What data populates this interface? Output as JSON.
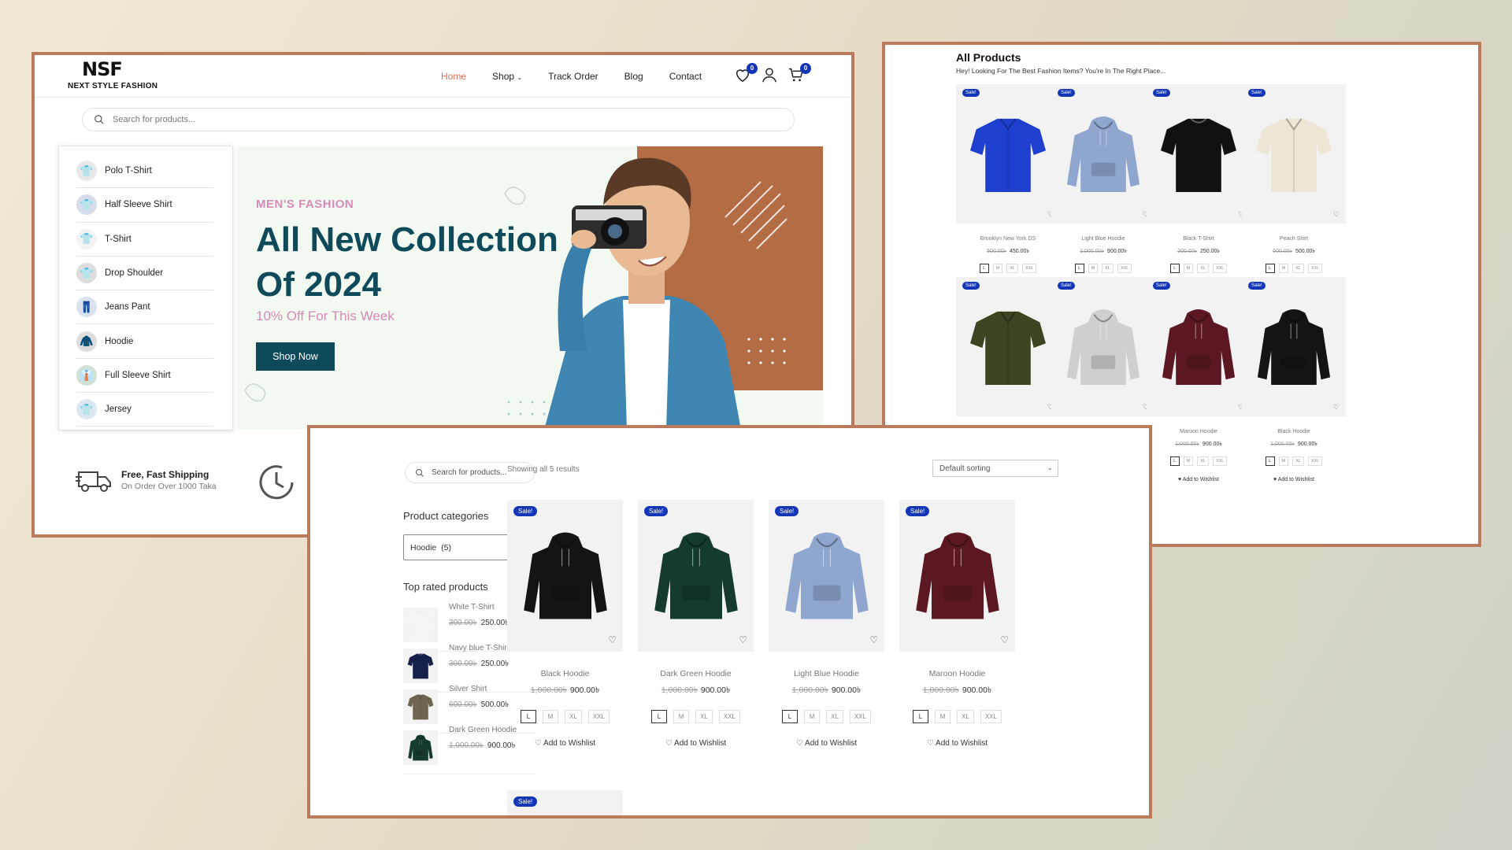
{
  "frame_a": {
    "logo_mark": "NSF",
    "logo_text": "NEXT STYLE FASHION",
    "nav": [
      "Home",
      "Shop",
      "Track Order",
      "Blog",
      "Contact"
    ],
    "wishlist_count": "0",
    "cart_count": "0",
    "search_placeholder": "Search for products...",
    "categories": [
      "Polo T-Shirt",
      "Half Sleeve Shirt",
      "T-Shirt",
      "Drop Shoulder",
      "Jeans Pant",
      "Hoodie",
      "Full Sleeve Shirt",
      "Jersey"
    ],
    "hero": {
      "subtitle": "MEN'S FASHION",
      "title": "All New Collection Of 2024",
      "offer": "10% Off For This Week",
      "button": "Shop Now"
    },
    "shipping": {
      "title": "Free, Fast Shipping",
      "subtitle": "On Order Over 1000 Taka"
    },
    "accent_color": "#e56f5c",
    "brand_color": "#0f4a5b"
  },
  "frame_b": {
    "title": "All Products",
    "subtitle": "Hey! Looking For The Best Fashion Items? You're In The Right Place...",
    "sale_label": "Sale!",
    "wishlist_label": "Add to Wishlist",
    "sizes": [
      "L",
      "M",
      "XL",
      "XXL"
    ],
    "products": [
      {
        "name": "Brooklyn New York DS",
        "old": "500.00৳",
        "price": "450.00৳",
        "color": "#1f3fcf"
      },
      {
        "name": "Light Blue Hoodie",
        "old": "1,000.00৳",
        "price": "900.00৳",
        "color": "#8fa6cf"
      },
      {
        "name": "Black T-Shirt",
        "old": "300.00৳",
        "price": "250.00৳",
        "color": "#111111"
      },
      {
        "name": "Peach Shirt",
        "old": "600.00৳",
        "price": "500.00৳",
        "color": "#ece6d7"
      },
      {
        "name": "",
        "old": "",
        "price": "",
        "color": "#3c4522"
      },
      {
        "name": "",
        "old": "",
        "price": "",
        "color": "#cfcfcf"
      },
      {
        "name": "Maroon Hoodie",
        "old": "1,000.00৳",
        "price": "900.00৳",
        "color": "#5c1822"
      },
      {
        "name": "Black Hoodie",
        "old": "1,000.00৳",
        "price": "900.00৳",
        "color": "#141414"
      }
    ]
  },
  "frame_c": {
    "search_placeholder": "Search for products...",
    "categories_heading": "Product categories",
    "selected_category": "Hoodie  (5)",
    "top_rated_heading": "Top rated products",
    "top_rated": [
      {
        "name": "White T-Shirt",
        "old": "300.00৳",
        "price": "250.00৳",
        "color": "#f4f4f4"
      },
      {
        "name": "Navy blue T-Shirt",
        "old": "300.00৳",
        "price": "250.00৳",
        "color": "#16204a"
      },
      {
        "name": "Silver Shirt",
        "old": "600.00৳",
        "price": "500.00৳",
        "color": "#6e6650"
      },
      {
        "name": "Dark Green Hoodie",
        "old": "1,000.00৳",
        "price": "900.00৳",
        "color": "#143b2c"
      }
    ],
    "showing": "Showing all 5 results",
    "sorting": "Default sorting",
    "sale_label": "Sale!",
    "wishlist_label": "Add to Wishlist",
    "sizes": [
      "L",
      "M",
      "XL",
      "XXL"
    ],
    "products": [
      {
        "name": "Black Hoodie",
        "old": "1,000.00৳",
        "price": "900.00৳",
        "color": "#141414"
      },
      {
        "name": "Dark Green Hoodie",
        "old": "1,000.00৳",
        "price": "900.00৳",
        "color": "#143b2c"
      },
      {
        "name": "Light Blue Hoodie",
        "old": "1,000.00৳",
        "price": "900.00৳",
        "color": "#8fa6cf"
      },
      {
        "name": "Maroon Hoodie",
        "old": "1,000.00৳",
        "price": "900.00৳",
        "color": "#5c1822"
      }
    ]
  }
}
